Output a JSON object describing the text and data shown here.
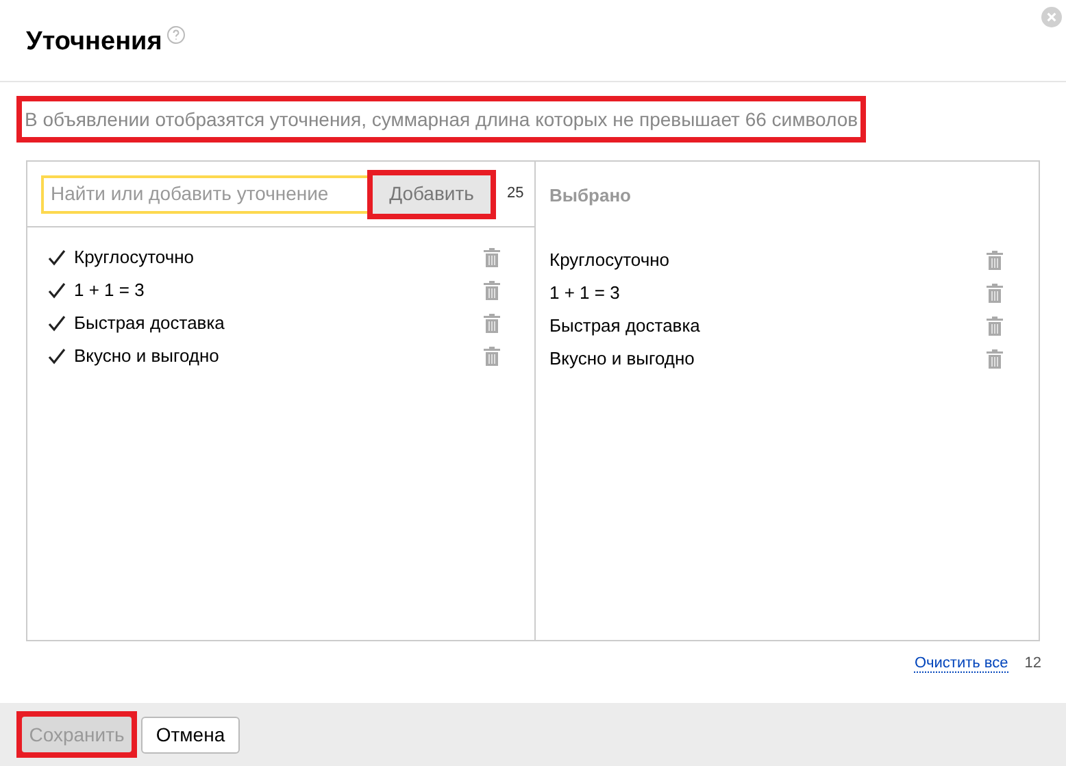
{
  "dialog": {
    "title": "Уточнения",
    "note": {
      "text": "В объявлении отобразятся уточнения, суммарная длина которых не превышает 66 символов",
      "highlighted": true
    }
  },
  "search": {
    "placeholder": "Найти или добавить уточнение",
    "add_button": {
      "label": "Добавить",
      "highlighted": true
    },
    "count": "25"
  },
  "suggestions": [
    {
      "label": "Круглосуточно",
      "checked": true
    },
    {
      "label": "1 + 1 = 3",
      "checked": true
    },
    {
      "label": "Быстрая доставка",
      "checked": true
    },
    {
      "label": "Вкусно и выгодно",
      "checked": true
    }
  ],
  "selected_panel": {
    "title": "Выбрано",
    "items": [
      "Круглосуточно",
      "1 + 1 = 3",
      "Быстрая доставка",
      "Вкусно и выгодно"
    ]
  },
  "clear_all": {
    "label": "Очистить все",
    "count": "12"
  },
  "footer": {
    "save_button": {
      "label": "Сохранить",
      "disabled": true,
      "highlighted": true
    },
    "cancel_button": {
      "label": "Отмена"
    }
  }
}
